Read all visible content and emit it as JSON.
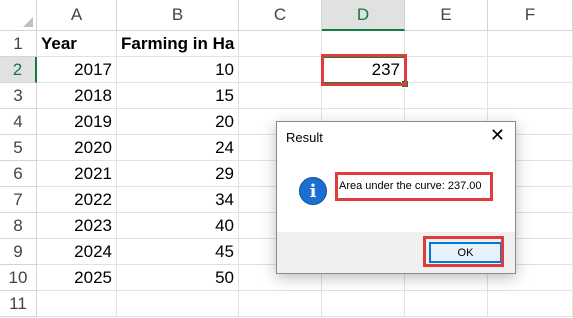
{
  "columns": [
    "A",
    "B",
    "C",
    "D",
    "E",
    "F"
  ],
  "rows": [
    "1",
    "2",
    "3",
    "4",
    "5",
    "6",
    "7",
    "8",
    "9",
    "10",
    "11"
  ],
  "table": {
    "header": {
      "year": "Year",
      "farming": "Farming in Ha"
    },
    "data": [
      {
        "year": "2017",
        "farming": "10"
      },
      {
        "year": "2018",
        "farming": "15"
      },
      {
        "year": "2019",
        "farming": "20"
      },
      {
        "year": "2020",
        "farming": "24"
      },
      {
        "year": "2021",
        "farming": "29"
      },
      {
        "year": "2022",
        "farming": "34"
      },
      {
        "year": "2023",
        "farming": "40"
      },
      {
        "year": "2024",
        "farming": "45"
      },
      {
        "year": "2025",
        "farming": "50"
      }
    ]
  },
  "result_cell": {
    "ref": "D2",
    "value": "237"
  },
  "dialog": {
    "title": "Result",
    "close_glyph": "✕",
    "icon": "info-icon",
    "icon_glyph": "i",
    "message": "Area under the curve: 237.00",
    "ok_label": "OK"
  },
  "colors": {
    "highlight": "#e03c3c",
    "excel_green": "#107c41",
    "info_blue": "#1a6fd1"
  }
}
